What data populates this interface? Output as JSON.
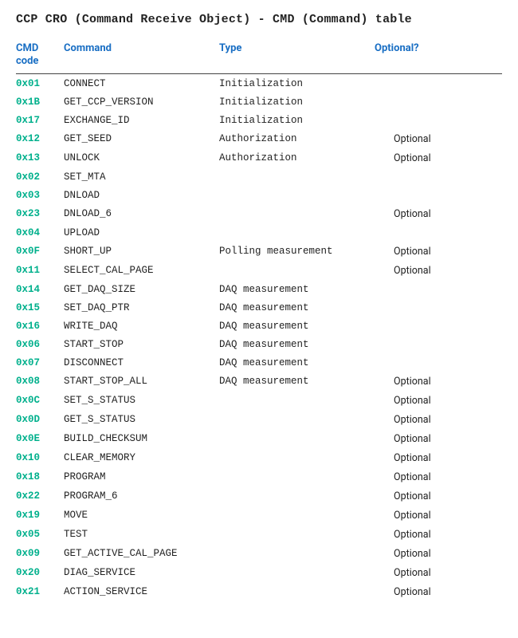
{
  "title": "CCP CRO (Command Receive Object) - CMD (Command) table",
  "headers": {
    "code": "CMD code",
    "command": "Command",
    "type": "Type",
    "optional": "Optional?"
  },
  "rows": [
    {
      "code": "0x01",
      "command": "CONNECT",
      "type": "Initialization",
      "optional": ""
    },
    {
      "code": "0x1B",
      "command": "GET_CCP_VERSION",
      "type": "Initialization",
      "optional": ""
    },
    {
      "code": "0x17",
      "command": "EXCHANGE_ID",
      "type": "Initialization",
      "optional": ""
    },
    {
      "code": "0x12",
      "command": "GET_SEED",
      "type": "Authorization",
      "optional": "Optional"
    },
    {
      "code": "0x13",
      "command": "UNLOCK",
      "type": "Authorization",
      "optional": "Optional"
    },
    {
      "code": "0x02",
      "command": "SET_MTA",
      "type": "",
      "optional": ""
    },
    {
      "code": "0x03",
      "command": "DNLOAD",
      "type": "",
      "optional": ""
    },
    {
      "code": "0x23",
      "command": "DNLOAD_6",
      "type": "",
      "optional": "Optional"
    },
    {
      "code": "0x04",
      "command": "UPLOAD",
      "type": "",
      "optional": ""
    },
    {
      "code": "0x0F",
      "command": "SHORT_UP",
      "type": "Polling measurement",
      "optional": "Optional"
    },
    {
      "code": "0x11",
      "command": "SELECT_CAL_PAGE",
      "type": "",
      "optional": "Optional"
    },
    {
      "code": "0x14",
      "command": "GET_DAQ_SIZE",
      "type": "DAQ measurement",
      "optional": ""
    },
    {
      "code": "0x15",
      "command": "SET_DAQ_PTR",
      "type": "DAQ measurement",
      "optional": ""
    },
    {
      "code": "0x16",
      "command": "WRITE_DAQ",
      "type": "DAQ measurement",
      "optional": ""
    },
    {
      "code": "0x06",
      "command": "START_STOP",
      "type": "DAQ measurement",
      "optional": ""
    },
    {
      "code": "0x07",
      "command": "DISCONNECT",
      "type": "DAQ measurement",
      "optional": ""
    },
    {
      "code": "0x08",
      "command": "START_STOP_ALL",
      "type": "DAQ measurement",
      "optional": "Optional"
    },
    {
      "code": "0x0C",
      "command": "SET_S_STATUS",
      "type": "",
      "optional": "Optional"
    },
    {
      "code": "0x0D",
      "command": "GET_S_STATUS",
      "type": "",
      "optional": "Optional"
    },
    {
      "code": "0x0E",
      "command": "BUILD_CHECKSUM",
      "type": "",
      "optional": "Optional"
    },
    {
      "code": "0x10",
      "command": "CLEAR_MEMORY",
      "type": "",
      "optional": "Optional"
    },
    {
      "code": "0x18",
      "command": "PROGRAM",
      "type": "",
      "optional": "Optional"
    },
    {
      "code": "0x22",
      "command": "PROGRAM_6",
      "type": "",
      "optional": "Optional"
    },
    {
      "code": "0x19",
      "command": "MOVE",
      "type": "",
      "optional": "Optional"
    },
    {
      "code": "0x05",
      "command": "TEST",
      "type": "",
      "optional": "Optional"
    },
    {
      "code": "0x09",
      "command": "GET_ACTIVE_CAL_PAGE",
      "type": "",
      "optional": "Optional"
    },
    {
      "code": "0x20",
      "command": "DIAG_SERVICE",
      "type": "",
      "optional": "Optional"
    },
    {
      "code": "0x21",
      "command": "ACTION_SERVICE",
      "type": "",
      "optional": "Optional"
    }
  ]
}
